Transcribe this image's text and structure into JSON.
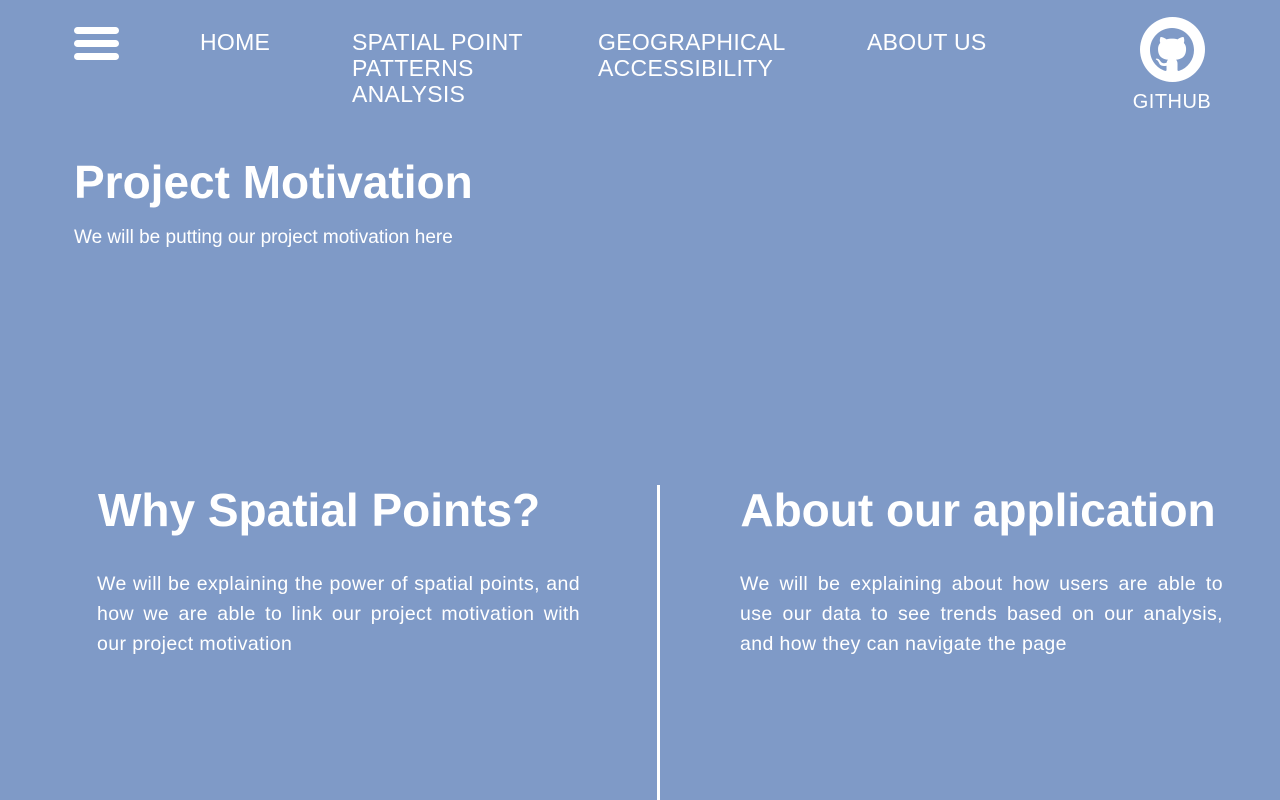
{
  "nav": {
    "menu_icon": "hamburger-menu-icon",
    "links": [
      "HOME",
      "SPATIAL POINT PATTERNS ANALYSIS",
      "GEOGRAPHICAL ACCESSIBILITY",
      "ABOUT US"
    ],
    "github": {
      "icon": "github-icon",
      "label": "GITHUB"
    }
  },
  "hero": {
    "title": "Project Motivation",
    "text": "We will be putting our project motivation here"
  },
  "sections": {
    "left": {
      "title": "Why Spatial Points?",
      "text": "We will be explaining the power of spatial points, and how we are able to link our project motivation with our project motivation"
    },
    "right": {
      "title": "About our application",
      "text": "We will be explaining about how users are able to use our data to see trends based on our analysis, and how they can navigate the page"
    }
  },
  "colors": {
    "background": "#7f9ac7",
    "foreground": "#ffffff"
  }
}
